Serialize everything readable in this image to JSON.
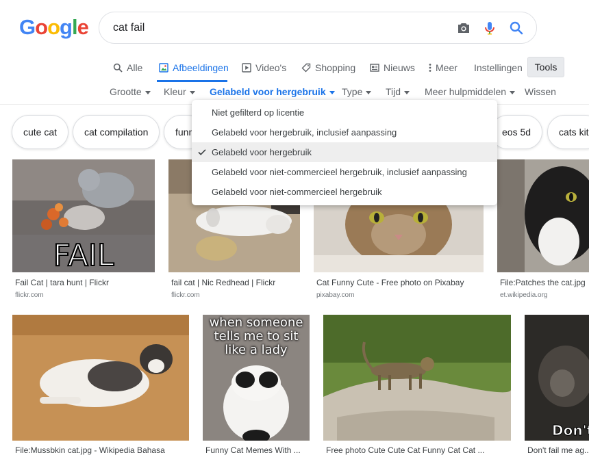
{
  "logo": {
    "letters": [
      "G",
      "o",
      "o",
      "g",
      "l",
      "e"
    ],
    "colors": [
      "#4285f4",
      "#ea4335",
      "#fbbc05",
      "#4285f4",
      "#34a853",
      "#ea4335"
    ]
  },
  "search": {
    "query": "cat fail"
  },
  "tabs": [
    {
      "label": "Alle",
      "icon": "search-icon"
    },
    {
      "label": "Afbeeldingen",
      "icon": "image-icon",
      "active": true
    },
    {
      "label": "Video's",
      "icon": "play-icon"
    },
    {
      "label": "Shopping",
      "icon": "tag-icon"
    },
    {
      "label": "Nieuws",
      "icon": "news-icon"
    },
    {
      "label": "Meer",
      "icon": "more-vert-icon"
    }
  ],
  "settings_label": "Instellingen",
  "tools_label": "Tools",
  "filters": [
    {
      "label": "Grootte"
    },
    {
      "label": "Kleur"
    },
    {
      "label": "Gelabeld voor hergebruik",
      "active": true
    },
    {
      "label": "Type"
    },
    {
      "label": "Tijd"
    },
    {
      "label": "Meer hulpmiddelen"
    }
  ],
  "clear_label": "Wissen",
  "chips": [
    "cute cat",
    "cat compilation",
    "funny",
    "eos 5d",
    "cats kit"
  ],
  "dropdown": {
    "items": [
      {
        "label": "Niet gefilterd op licentie"
      },
      {
        "label": "Gelabeld voor hergebruik, inclusief aanpassing"
      },
      {
        "label": "Gelabeld voor hergebruik",
        "selected": true
      },
      {
        "label": "Gelabeld voor niet-commercieel hergebruik, inclusief aanpassing"
      },
      {
        "label": "Gelabeld voor niet-commercieel hergebruik"
      }
    ]
  },
  "results": [
    {
      "title": "Fail Cat | tara hunt | Flickr",
      "source": "flickr.com",
      "overlay": "FAIL"
    },
    {
      "title": "fail cat | Nic Redhead | Flickr",
      "source": "flickr.com"
    },
    {
      "title": "Cat Funny Cute - Free photo on Pixabay",
      "source": "pixabay.com"
    },
    {
      "title": "File:Patches the cat.jpg",
      "source": "et.wikipedia.org"
    },
    {
      "title": "File:Mussbkin cat.jpg - Wikipedia Bahasa",
      "source": ""
    },
    {
      "title": "Funny Cat Memes With ...",
      "source": "",
      "overlay": "when someone tells me to sit like a lady"
    },
    {
      "title": "Free photo Cute Cute Cat Funny Cat Cat ...",
      "source": ""
    },
    {
      "title": "Don't fail me ag...",
      "source": "",
      "overlay": "Don't f"
    }
  ]
}
